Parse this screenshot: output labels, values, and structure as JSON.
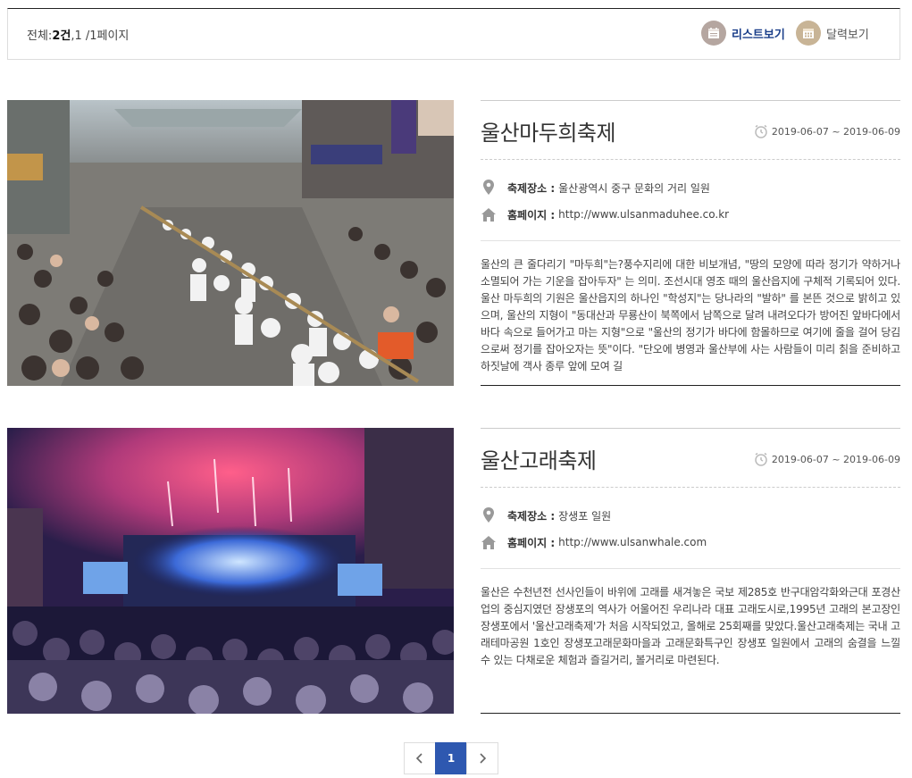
{
  "summary": {
    "prefix": "전체:",
    "count": "2건",
    "page_info": ",1 /1페이지"
  },
  "view": {
    "list_label": "리스트보기",
    "calendar_label": "달력보기"
  },
  "festivals": [
    {
      "title": "울산마두희축제",
      "date": "2019-06-07 ~ 2019-06-09",
      "place_label": "축제장소 :",
      "place": "울산광역시 중구 문화의 거리 일원",
      "homepage_label": "홈페이지 :",
      "homepage": "http://www.ulsanmaduhee.co.kr",
      "description": "울산의 큰 줄다리기 \"마두희\"는?풍수지리에 대한 비보개념, \"땅의 모양에 따라 정기가 약하거나 소멸되어 가는 기운을 잡아두자\" 는 의미. 조선시대 영조 때의 울산읍지에 구체적 기록되어 있다. 울산 마두희의 기원은 울산읍지의 하나인 \"학성지\"는 당나라의 \"발하\" 를 본뜬 것으로 밝히고 있으며, 울산의 지형이 \"동대산과 무룡산이 북쪽에서 남쪽으로 달려 내려오다가 방어진 앞바다에서 바다 속으로 들어가고 마는 지형\"으로 \"울산의 정기가 바다에 함몰하므로 여기에 줄을 걸어 당김으로써 정기를 잡아오자는 뜻\"이다. \"단오에 병영과 울산부에 사는 사람들이 미리 칡을 준비하고 하짓날에 객사 종루 앞에 모여 길"
    },
    {
      "title": "울산고래축제",
      "date": "2019-06-07 ~ 2019-06-09",
      "place_label": "축제장소 :",
      "place": "장생포 일원",
      "homepage_label": "홈페이지 :",
      "homepage": "http://www.ulsanwhale.com",
      "description": "울산은 수천년전 선사인들이 바위에 고래를 새겨놓은 국보 제285호 반구대암각화와근대 포경산업의 중심지였던 장생포의 역사가 어울어진 우리나라 대표 고래도시로,1995년 고래의 본고장인 장생포에서 '울산고래축제'가 처음 시작되었고, 올해로 25회째를 맞았다.울산고래축제는 국내 고래테마공원 1호인 장생포고래문화마을과 고래문화특구인 장생포 일원에서 고래의 숨결을 느낄 수 있는 다채로운 체험과 즐길거리, 볼거리로 마련된다."
    }
  ],
  "pagination": {
    "prev_icon": "chevron-left-icon",
    "current": "1",
    "next_icon": "chevron-right-icon"
  }
}
